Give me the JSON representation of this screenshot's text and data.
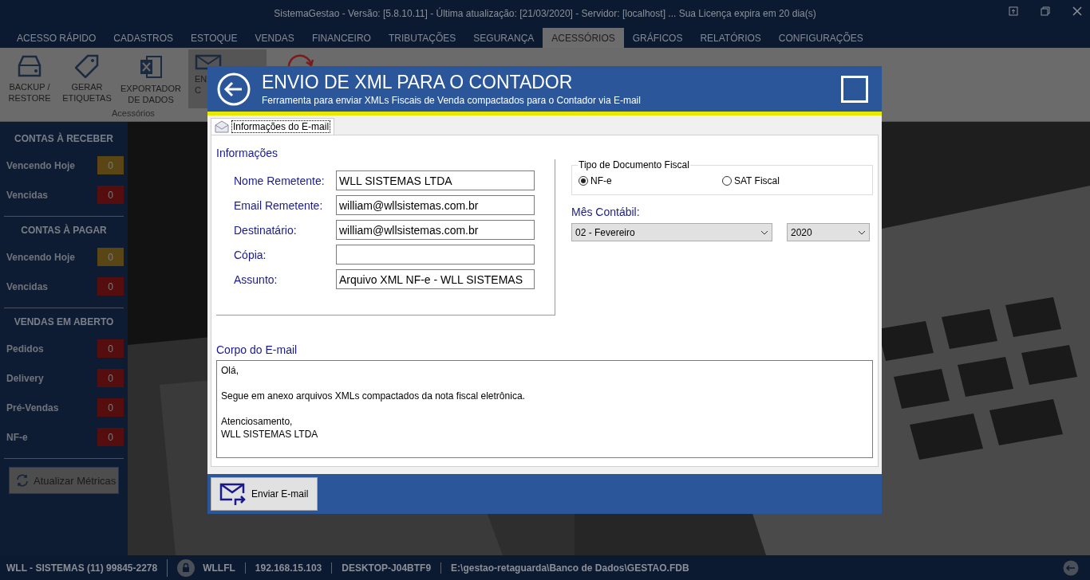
{
  "window": {
    "title": "SistemaGestao - Versão: [5.8.10.11] - Última atualização: [21/03/2020] - Servidor: [localhost] ... Sua Licença expira em 20 dia(s)"
  },
  "menu_tabs": [
    {
      "label": "ACESSO RÁPIDO",
      "selected": false
    },
    {
      "label": "CADASTROS",
      "selected": false
    },
    {
      "label": "ESTOQUE",
      "selected": false
    },
    {
      "label": "VENDAS",
      "selected": false
    },
    {
      "label": "FINANCEIRO",
      "selected": false
    },
    {
      "label": "TRIBUTAÇÕES",
      "selected": false
    },
    {
      "label": "SEGURANÇA",
      "selected": false
    },
    {
      "label": "ACESSÓRIOS",
      "selected": true
    },
    {
      "label": "GRÁFICOS",
      "selected": false
    },
    {
      "label": "RELATÓRIOS",
      "selected": false
    },
    {
      "label": "CONFIGURAÇÕES",
      "selected": false
    }
  ],
  "ribbon": {
    "group_label": "Acessórios",
    "buttons": [
      {
        "kind": "backup",
        "lines": [
          "BACKUP /",
          "RESTORE"
        ],
        "selected": false
      },
      {
        "kind": "tag",
        "lines": [
          "GERAR",
          "ETIQUETAS"
        ],
        "selected": false
      },
      {
        "kind": "excel",
        "lines": [
          "EXPORTADOR",
          "DE DADOS"
        ],
        "selected": false
      },
      {
        "kind": "mail",
        "lines": [
          "EN",
          "C"
        ],
        "selected": true
      }
    ]
  },
  "sidebar": {
    "sections": [
      {
        "title": "CONTAS À RECEBER",
        "rows": [
          {
            "label": "Vencendo Hoje",
            "count": "0",
            "color": "#5a4614"
          },
          {
            "label": "Vencidas",
            "count": "0",
            "color": "#560d0d"
          }
        ]
      },
      {
        "title": "CONTAS À PAGAR",
        "rows": [
          {
            "label": "Vencendo Hoje",
            "count": "0",
            "color": "#5a4614"
          },
          {
            "label": "Vencidas",
            "count": "0",
            "color": "#560d0d"
          }
        ]
      },
      {
        "title": "VENDAS EM ABERTO",
        "rows": [
          {
            "label": "Pedidos",
            "count": "0",
            "color": "#560d0d"
          },
          {
            "label": "Delivery",
            "count": "0",
            "color": "#560d0d"
          },
          {
            "label": "Pré-Vendas",
            "count": "0",
            "color": "#560d0d"
          },
          {
            "label": "NF-e",
            "count": "0",
            "color": "#560d0d"
          }
        ]
      }
    ],
    "refresh_button": "Atualizar Métricas"
  },
  "status_bar": {
    "items": [
      {
        "kind": "text",
        "text": "WLL - SISTEMAS (11) 99845-2278"
      },
      {
        "kind": "user",
        "text": "WLLFL"
      },
      {
        "kind": "text",
        "text": "192.168.15.103"
      },
      {
        "kind": "text",
        "text": "DESKTOP-J04BTF9"
      },
      {
        "kind": "text",
        "text": "E:\\gestao-retaguarda\\Banco de Dados\\GESTAO.FDB"
      }
    ]
  },
  "dialog": {
    "title": "ENVIO DE XML PARA O CONTADOR",
    "subtitle": "Ferramenta para enviar XMLs Fiscais de Venda compactados para o Contador via E-mail",
    "tabs": [
      {
        "label": "Informações do E-mail",
        "selected": true
      }
    ],
    "info_heading": "Informações",
    "fields": [
      {
        "label": "Nome Remetente:",
        "value": "WLL SISTEMAS LTDA"
      },
      {
        "label": "Email Remetente:",
        "value": "william@wllsistemas.com.br"
      },
      {
        "label": "Destinatário:",
        "value": "william@wllsistemas.com.br"
      },
      {
        "label": "Cópia:"
      },
      {
        "label": "Assunto:",
        "value": "Arquivo XML NF-e - WLL SISTEMAS"
      }
    ],
    "doc_type": {
      "legend": "Tipo de Documento Fiscal",
      "options": [
        {
          "label": "NF-e",
          "selected": true
        },
        {
          "label": "SAT Fiscal",
          "selected": false
        }
      ]
    },
    "month_label": "Mês Contábil:",
    "month": "02 - Fevereiro",
    "year": "2020",
    "body_label": "Corpo do E-mail",
    "body": "Olá,\n\nSegue em anexo arquivos XMLs compactados da nota fiscal eletrônica.\n\nAtenciosamento,\nWLL SISTEMAS LTDA",
    "send_button": "Enviar E-mail"
  }
}
